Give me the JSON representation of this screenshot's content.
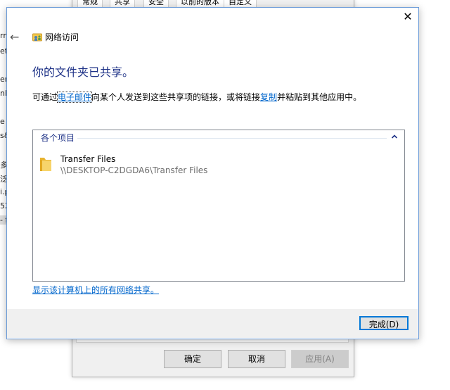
{
  "background_window": {
    "tabs": [
      "常规",
      "共享",
      "安全",
      "以前的版本",
      "自定义"
    ],
    "buttons": {
      "ok": "确定",
      "cancel": "取消",
      "apply": "应用(A)"
    }
  },
  "left_window_strip": [
    "rn",
    "et",
    "ers",
    "nlo",
    "e",
    "s&",
    "多人",
    "泛",
    "i.p",
    "52",
    "- f"
  ],
  "dialog": {
    "title": "网络访问",
    "heading": "你的文件夹已共享。",
    "description": {
      "prefix": "可通过",
      "email_link": "电子邮件",
      "middle": "向某个人发送到这些共享项的链接，或将链接",
      "copy_link": "复制",
      "suffix": "并粘贴到其他应用中。"
    },
    "group_header": "各个项目",
    "item": {
      "name": "Transfer Files",
      "path": "\\\\DESKTOP-C2DGDA6\\Transfer Files"
    },
    "show_all_link": "显示该计算机上的所有网络共享。",
    "done_button": "完成(D)"
  },
  "icons": {
    "close": "close-icon",
    "back": "back-arrow-icon",
    "network": "network-share-icon",
    "folder": "folder-icon",
    "collapse": "chevron-up-icon"
  },
  "colors": {
    "heading": "#1e3287",
    "link": "#0066cc",
    "focus_border": "#0078d7",
    "folder": "#f4c94a"
  }
}
